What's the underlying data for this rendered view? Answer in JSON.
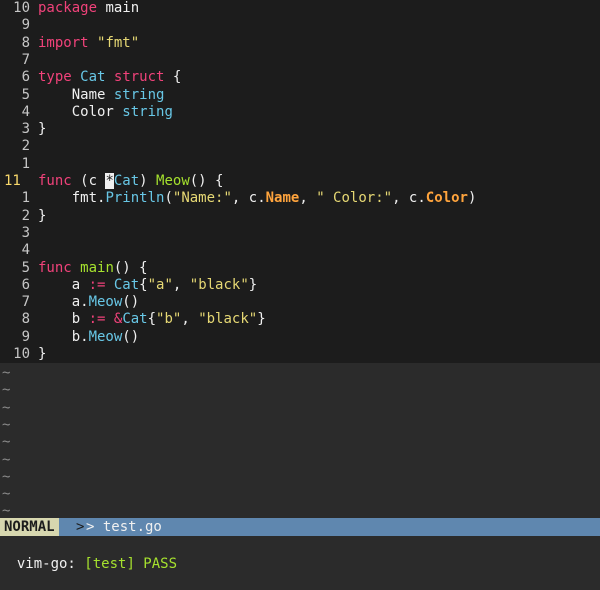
{
  "code_lines": [
    {
      "ln": "10",
      "parts": [
        [
          "kw",
          "package"
        ],
        [
          "plain",
          " main"
        ]
      ]
    },
    {
      "ln": "9",
      "parts": []
    },
    {
      "ln": "8",
      "parts": [
        [
          "kw",
          "import"
        ],
        [
          "plain",
          " "
        ],
        [
          "str",
          "\"fmt\""
        ]
      ]
    },
    {
      "ln": "7",
      "parts": []
    },
    {
      "ln": "6",
      "parts": [
        [
          "kw",
          "type"
        ],
        [
          "plain",
          " "
        ],
        [
          "ty",
          "Cat"
        ],
        [
          "plain",
          " "
        ],
        [
          "kw",
          "struct"
        ],
        [
          "plain",
          " {"
        ]
      ]
    },
    {
      "ln": "5",
      "parts": [
        [
          "plain",
          "    Name "
        ],
        [
          "ty",
          "string"
        ]
      ]
    },
    {
      "ln": "4",
      "parts": [
        [
          "plain",
          "    Color "
        ],
        [
          "ty",
          "string"
        ]
      ]
    },
    {
      "ln": "3",
      "parts": [
        [
          "plain",
          "}"
        ]
      ]
    },
    {
      "ln": "2",
      "parts": []
    },
    {
      "ln": "1",
      "parts": []
    },
    {
      "ln": "11",
      "current": true,
      "parts": [
        [
          "kw",
          "func"
        ],
        [
          "plain",
          " (c "
        ],
        [
          "cursor",
          "*"
        ],
        [
          "ty",
          "Cat"
        ],
        [
          "plain",
          ") "
        ],
        [
          "fnname",
          "Meow"
        ],
        [
          "plain",
          "() {"
        ]
      ]
    },
    {
      "ln": "1",
      "parts": [
        [
          "plain",
          "    fmt."
        ],
        [
          "fn",
          "Println"
        ],
        [
          "plain",
          "("
        ],
        [
          "str",
          "\"Name:\""
        ],
        [
          "plain",
          ", c."
        ],
        [
          "fld",
          "Name"
        ],
        [
          "plain",
          ", "
        ],
        [
          "str",
          "\" Color:\""
        ],
        [
          "plain",
          ", c."
        ],
        [
          "fld",
          "Color"
        ],
        [
          "plain",
          ")"
        ]
      ]
    },
    {
      "ln": "2",
      "parts": [
        [
          "plain",
          "}"
        ]
      ]
    },
    {
      "ln": "3",
      "parts": []
    },
    {
      "ln": "4",
      "parts": []
    },
    {
      "ln": "5",
      "parts": [
        [
          "kw",
          "func"
        ],
        [
          "plain",
          " "
        ],
        [
          "fnname",
          "main"
        ],
        [
          "plain",
          "() {"
        ]
      ]
    },
    {
      "ln": "6",
      "parts": [
        [
          "plain",
          "    a "
        ],
        [
          "op",
          ":="
        ],
        [
          "plain",
          " "
        ],
        [
          "ty",
          "Cat"
        ],
        [
          "plain",
          "{"
        ],
        [
          "str",
          "\"a\""
        ],
        [
          "plain",
          ", "
        ],
        [
          "str",
          "\"black\""
        ],
        [
          "plain",
          "}"
        ]
      ]
    },
    {
      "ln": "7",
      "parts": [
        [
          "plain",
          "    a."
        ],
        [
          "fn",
          "Meow"
        ],
        [
          "plain",
          "()"
        ]
      ]
    },
    {
      "ln": "8",
      "parts": [
        [
          "plain",
          "    b "
        ],
        [
          "op",
          ":="
        ],
        [
          "plain",
          " "
        ],
        [
          "op",
          "&"
        ],
        [
          "ty",
          "Cat"
        ],
        [
          "plain",
          "{"
        ],
        [
          "str",
          "\"b\""
        ],
        [
          "plain",
          ", "
        ],
        [
          "str",
          "\"black\""
        ],
        [
          "plain",
          "}"
        ]
      ]
    },
    {
      "ln": "9",
      "parts": [
        [
          "plain",
          "    b."
        ],
        [
          "fn",
          "Meow"
        ],
        [
          "plain",
          "()"
        ]
      ]
    },
    {
      "ln": "10",
      "parts": [
        [
          "plain",
          "}"
        ]
      ]
    }
  ],
  "tilde_lines": [
    "~",
    "~",
    "~",
    "~",
    "~",
    "~",
    "~",
    "~",
    "~",
    "~"
  ],
  "statusline": {
    "mode": "NORMAL",
    "separator": ">",
    "filename": "> test.go"
  },
  "cmdline": {
    "prefix": "vim-go: ",
    "result": "[test] PASS"
  },
  "colors": {
    "keyword": "#f0427a",
    "type": "#68c7e6",
    "string": "#e6d874",
    "field": "#ffa43d",
    "function_name": "#a6e22e",
    "statusline_bg": "#5f87af",
    "mode_bg": "#d7d7af"
  }
}
